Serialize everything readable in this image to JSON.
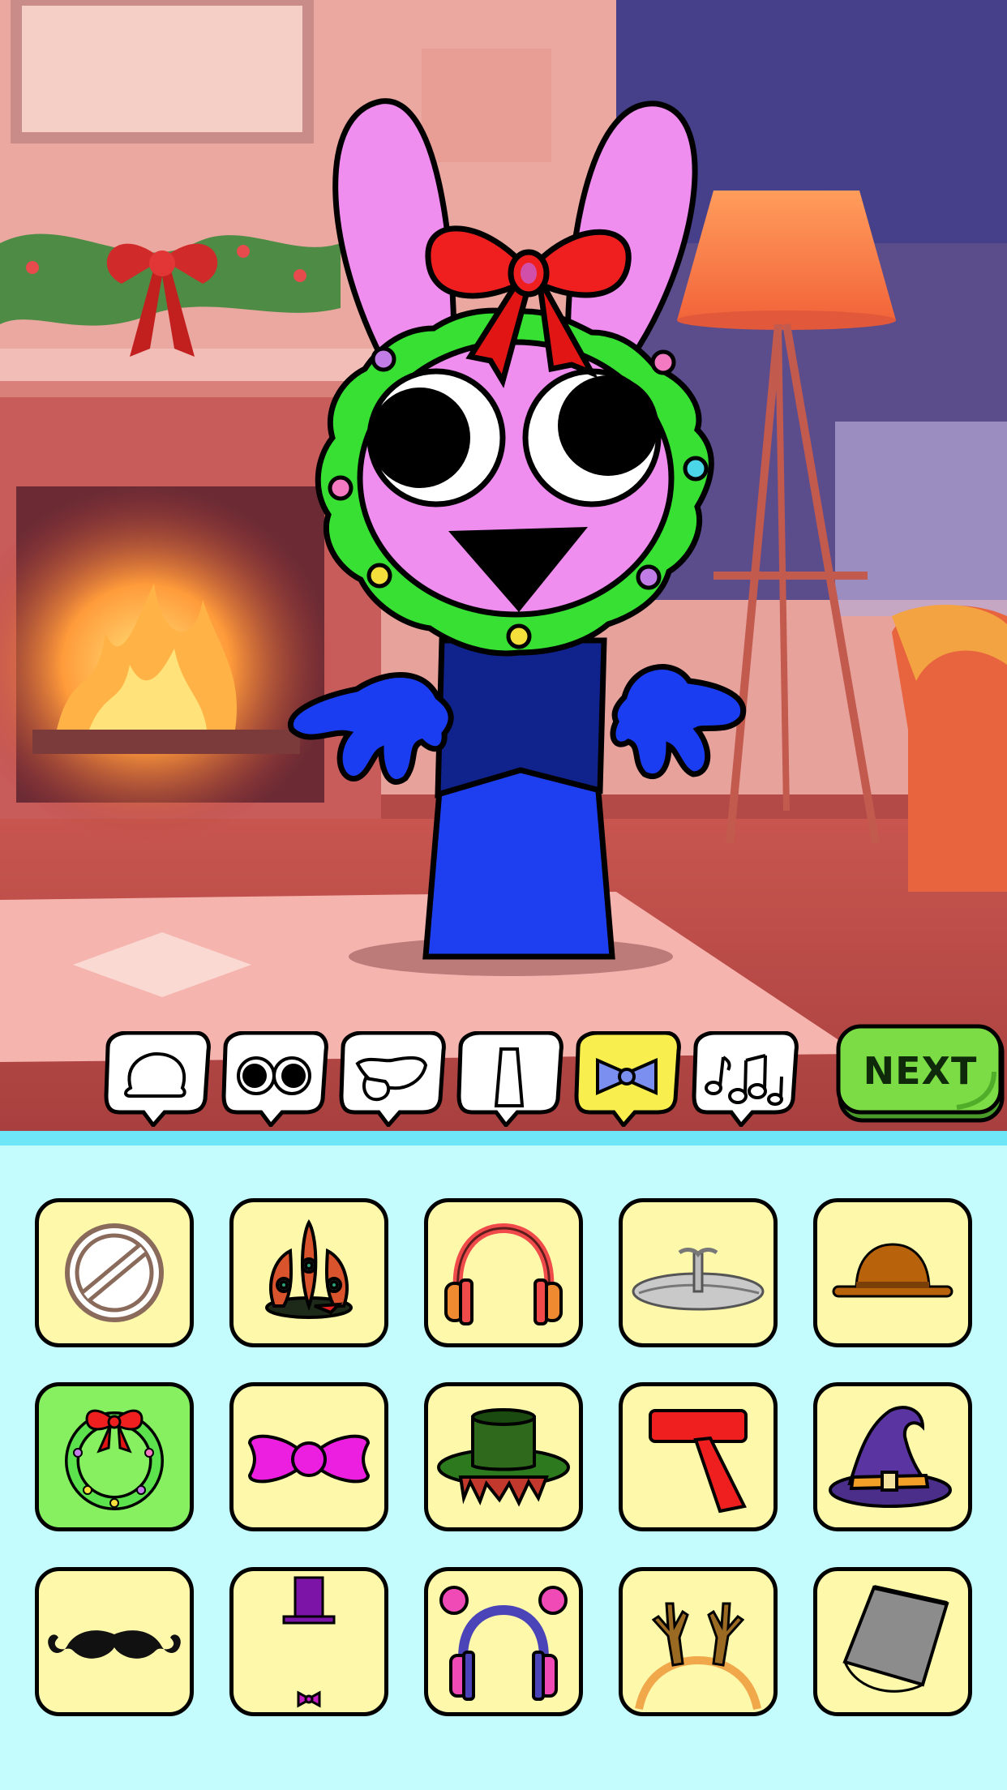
{
  "app": {
    "next_label": "NEXT"
  },
  "category_tabs": [
    {
      "id": "head",
      "icon": "head-outline-icon",
      "active": false
    },
    {
      "id": "eyes",
      "icon": "eyes-icon",
      "active": false
    },
    {
      "id": "mouth",
      "icon": "mouth-icon",
      "active": false
    },
    {
      "id": "body",
      "icon": "body-icon",
      "active": false
    },
    {
      "id": "accessory",
      "icon": "bow-tie-icon",
      "active": true
    },
    {
      "id": "music",
      "icon": "music-notes-icon",
      "active": false
    }
  ],
  "accessories": [
    {
      "id": "none",
      "icon": "none-icon",
      "selected": false
    },
    {
      "id": "feather-crown",
      "icon": "feather-crown-icon",
      "selected": false
    },
    {
      "id": "headphones-red",
      "icon": "headphones-icon",
      "selected": false
    },
    {
      "id": "propeller-disc",
      "icon": "propeller-disc-icon",
      "selected": false
    },
    {
      "id": "bowler-hat",
      "icon": "bowler-hat-icon",
      "selected": false
    },
    {
      "id": "christmas-wreath",
      "icon": "wreath-icon",
      "selected": true
    },
    {
      "id": "bow-tie",
      "icon": "bow-tie-icon",
      "selected": false
    },
    {
      "id": "slime-top-hat",
      "icon": "top-hat-icon",
      "selected": false
    },
    {
      "id": "red-scarf",
      "icon": "scarf-icon",
      "selected": false
    },
    {
      "id": "witch-hat",
      "icon": "witch-hat-icon",
      "selected": false
    },
    {
      "id": "mustache",
      "icon": "mustache-icon",
      "selected": false
    },
    {
      "id": "mini-top-hat-bowtie",
      "icon": "mini-top-hat-icon",
      "selected": false
    },
    {
      "id": "pom-headphones",
      "icon": "pom-headphones-icon",
      "selected": false
    },
    {
      "id": "reindeer-antlers",
      "icon": "antlers-icon",
      "selected": false
    },
    {
      "id": "bucket",
      "icon": "bucket-icon",
      "selected": false
    }
  ],
  "colors": {
    "panel_bg": "#c4fbfd",
    "cell_bg": "#fdf8aa",
    "cell_selected": "#86f061",
    "next_button": "#7cdc45",
    "active_tab": "#f8ef4e"
  }
}
